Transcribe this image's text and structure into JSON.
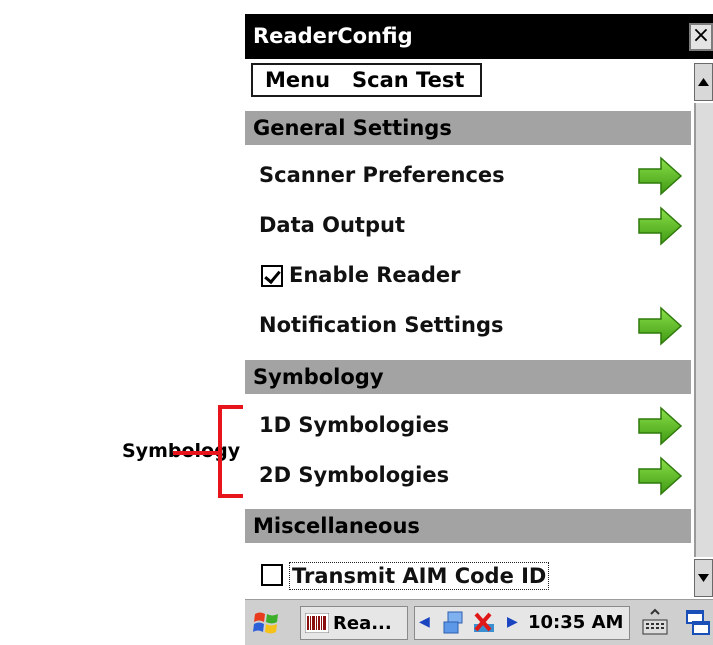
{
  "annotation": {
    "label": "Symbology",
    "color": "#e8141c"
  },
  "window": {
    "title": "ReaderConfig",
    "close_label": "×"
  },
  "menu": {
    "items": [
      "Menu",
      "Scan Test"
    ]
  },
  "sections": {
    "general": "General Settings",
    "symbology": "Symbology",
    "misc": "Miscellaneous"
  },
  "items": {
    "scanner_preferences": "Scanner Preferences",
    "data_output": "Data Output",
    "enable_reader": {
      "label": "Enable Reader",
      "checked": true
    },
    "notification_settings": "Notification Settings",
    "symbologies_1d": "1D Symbologies",
    "symbologies_2d": "2D Symbologies",
    "transmit_aim": {
      "label": "Transmit AIM Code ID",
      "checked": false
    }
  },
  "taskbar": {
    "task_label": "Rea...",
    "clock": "10:35 AM"
  },
  "colors": {
    "section_header": "#a3a3a3",
    "arrow_green": "#5bbf1e",
    "titlebar": "#000000"
  },
  "icons": [
    "arrow-right-icon",
    "start-icon",
    "network-icon",
    "keyboard-icon",
    "windows-icon"
  ]
}
